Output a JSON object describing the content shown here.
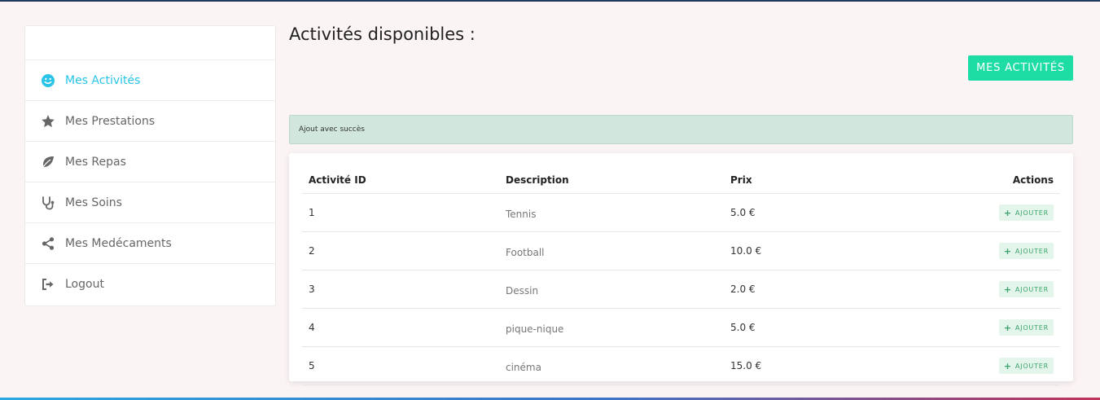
{
  "sidebar": {
    "items": [
      {
        "label": "Mes Activités",
        "icon": "smiley-icon",
        "active": true
      },
      {
        "label": "Mes Prestations",
        "icon": "star-icon",
        "active": false
      },
      {
        "label": "Mes Repas",
        "icon": "leaf-icon",
        "active": false
      },
      {
        "label": "Mes Soins",
        "icon": "stethoscope-icon",
        "active": false
      },
      {
        "label": "Mes Medécaments",
        "icon": "share-icon",
        "active": false
      },
      {
        "label": "Logout",
        "icon": "logout-icon",
        "active": false
      }
    ]
  },
  "main": {
    "title": "Activités disponibles :",
    "my_activities_button": "MES ACTIVITÉS",
    "alert": "Ajout avec succès",
    "table": {
      "headers": {
        "id": "Activité ID",
        "description": "Description",
        "price": "Prix",
        "actions": "Actions"
      },
      "rows": [
        {
          "id": "1",
          "description": "Tennis",
          "price": "5.0 €",
          "action": "AJOUTER"
        },
        {
          "id": "2",
          "description": "Football",
          "price": "10.0 €",
          "action": "AJOUTER"
        },
        {
          "id": "3",
          "description": "Dessin",
          "price": "2.0 €",
          "action": "AJOUTER"
        },
        {
          "id": "4",
          "description": "pique-nique",
          "price": "5.0 €",
          "action": "AJOUTER"
        },
        {
          "id": "5",
          "description": "cinéma",
          "price": "15.0 €",
          "action": "AJOUTER"
        }
      ]
    }
  },
  "colors": {
    "accent": "#29c4e8",
    "primary_button": "#1ddca4",
    "alert_bg": "#d1e7dd",
    "ajouter_text": "#3aa46a",
    "page_bg": "#fbf4f4"
  }
}
